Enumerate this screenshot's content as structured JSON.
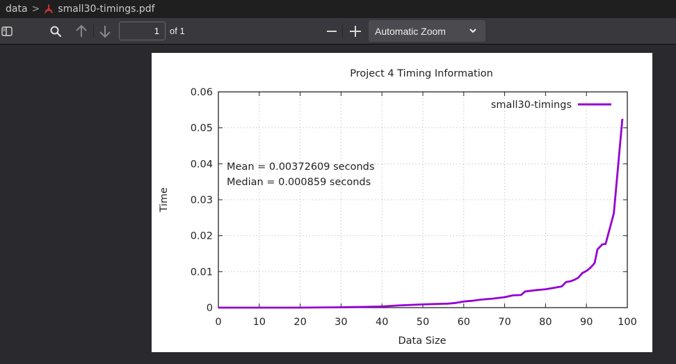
{
  "breadcrumb": {
    "folder": "data",
    "separator": ">",
    "file_icon": "pdf-icon",
    "file": "small30-timings.pdf"
  },
  "toolbar": {
    "sidebar_toggle_icon": "sidebar-toggle-icon",
    "find_icon": "search-icon",
    "prev_icon": "arrow-up-icon",
    "next_icon": "arrow-down-icon",
    "page_number": "1",
    "page_count": "of 1",
    "zoom_out_icon": "minus-icon",
    "zoom_in_icon": "plus-icon",
    "zoom_value": "Automatic Zoom",
    "zoom_dropdown_icon": "chevron-down-icon"
  },
  "colors": {
    "series": "#9400d3",
    "breadcrumb_bg": "#1f1f1f",
    "toolbar_bg": "#38383d",
    "viewer_bg": "#2a2a2e",
    "pdf_icon": "#d13438"
  },
  "chart_data": {
    "type": "line",
    "title": "Project 4 Timing Information",
    "xlabel": "Data Size",
    "ylabel": "Time",
    "xlim": [
      0,
      100
    ],
    "ylim": [
      0,
      0.06
    ],
    "xticks": [
      "0",
      "10",
      "20",
      "30",
      "40",
      "50",
      "60",
      "70",
      "80",
      "90",
      "100"
    ],
    "yticks": [
      "0",
      "0.01",
      "0.02",
      "0.03",
      "0.04",
      "0.05",
      "0.06"
    ],
    "grid": true,
    "legend_position": "top-right",
    "annotations": [
      "Mean = 0.00372609 seconds",
      "Median = 0.000859 seconds"
    ],
    "series": [
      {
        "name": "small30-timings",
        "x": [
          0,
          10,
          20,
          30,
          35,
          40,
          44,
          48,
          50,
          53,
          56,
          58,
          60,
          62,
          64,
          67,
          70,
          72,
          74,
          75,
          78,
          80,
          82,
          84,
          85,
          86,
          87,
          88,
          89,
          90,
          91,
          92,
          92.7,
          93.9,
          94.7,
          96.7,
          98.8
        ],
        "y": [
          0,
          0,
          0,
          0.0001,
          0.0002,
          0.0003,
          0.0006,
          0.0008,
          0.0009,
          0.001,
          0.0011,
          0.0013,
          0.0017,
          0.0019,
          0.0022,
          0.0025,
          0.0029,
          0.0034,
          0.0035,
          0.0045,
          0.0049,
          0.0051,
          0.0055,
          0.0059,
          0.0071,
          0.0073,
          0.0077,
          0.0083,
          0.0096,
          0.0102,
          0.0111,
          0.0124,
          0.0162,
          0.0176,
          0.0177,
          0.0262,
          0.0525
        ]
      }
    ]
  }
}
